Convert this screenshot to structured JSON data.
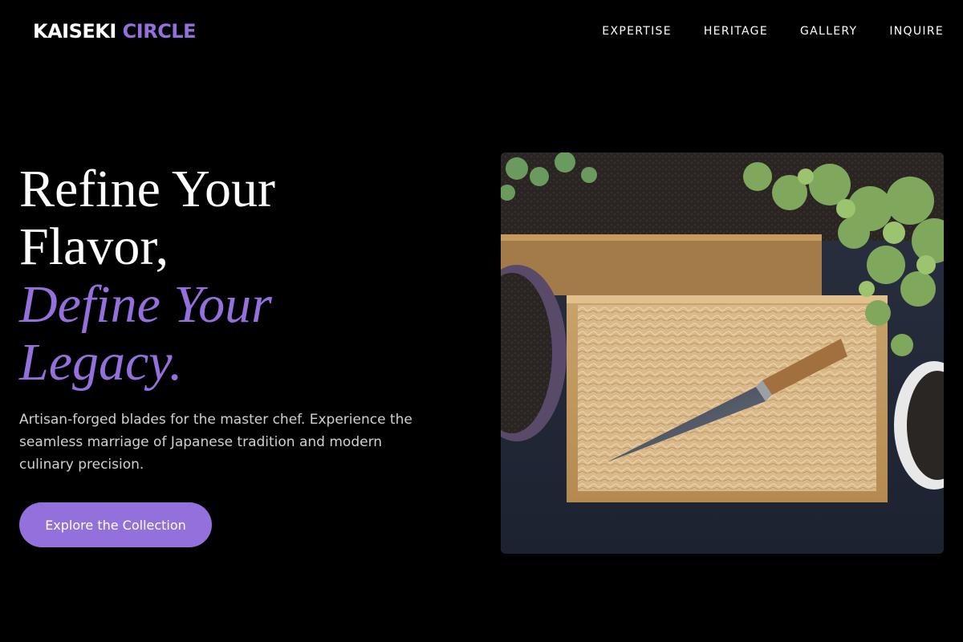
{
  "brand": {
    "name_primary": "KAISEKI",
    "name_accent": "CIRCLE",
    "accent_color": "#9370db"
  },
  "nav": {
    "items": [
      {
        "label": "EXPERTISE"
      },
      {
        "label": "HERITAGE"
      },
      {
        "label": "GALLERY"
      },
      {
        "label": "INQUIRE"
      }
    ]
  },
  "hero": {
    "headline_line1": "Refine Your",
    "headline_line2": "Flavor,",
    "headline_accent_line1": "Define Your",
    "headline_accent_line2": "Legacy.",
    "description": "Artisan-forged blades for the master chef. Experience the seamless marriage of Japanese tradition and modern culinary precision.",
    "cta_label": "Explore the Collection"
  },
  "colors": {
    "background": "#000000",
    "accent": "#9370db",
    "text": "#ffffff"
  }
}
